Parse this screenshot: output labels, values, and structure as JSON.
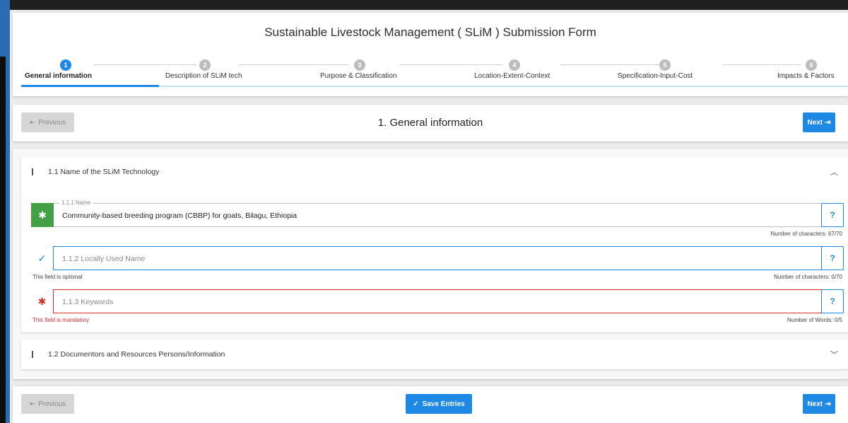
{
  "form": {
    "title": "Sustainable Livestock Management ( SLiM ) Submission Form"
  },
  "steps": [
    {
      "number": "1",
      "label": "General information",
      "active": true
    },
    {
      "number": "2",
      "label": "Description of SLiM tech"
    },
    {
      "number": "3",
      "label": "Purpose & Classification"
    },
    {
      "number": "4",
      "label": "Location-Extent-Context"
    },
    {
      "number": "5",
      "label": "Specification-Input-Cost"
    },
    {
      "number": "6",
      "label": "Impacts & Factors"
    }
  ],
  "nav": {
    "previous_label": "Previous",
    "next_label": "Next",
    "save_label": "Save Entries",
    "section_heading": "1. General information"
  },
  "sections": {
    "s11": {
      "title": "1.1 Name of the SLiM Technology",
      "name_field": {
        "label": "1.1.1 Name",
        "value": "Community-based breeding program (CBBP) for goats, Bilagu, Ethiopia",
        "counter": "Number of characters: 67/70"
      },
      "local_name_field": {
        "placeholder": "1.1.2 Locally Used Name",
        "hint": "This field is optional",
        "counter": "Number of characters: 0/70"
      },
      "keywords_field": {
        "placeholder": "1.1.3 Keywords",
        "hint": "This field is mandatory",
        "counter": "Number of Words: 0/5"
      },
      "help": "?"
    },
    "s12": {
      "title": "1.2 Documentors and Resources Persons/Information"
    }
  },
  "colors": {
    "primary": "#1e88e5",
    "success": "#43a047",
    "error": "#d32f2f",
    "disabled": "#d6d6d6"
  },
  "icons": {
    "previous": "arrow-left-bar-icon",
    "next": "arrow-right-bar-icon",
    "save": "check-icon",
    "collapse": "chevron-up-icon",
    "expand": "chevron-down-icon",
    "required": "asterisk-icon",
    "optional": "check-icon"
  }
}
